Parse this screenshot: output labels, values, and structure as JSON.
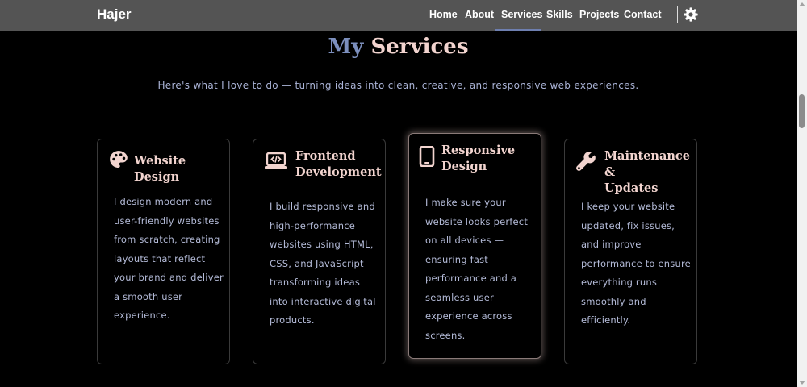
{
  "navbar": {
    "brand": "Hajer",
    "links": [
      {
        "label": "Home",
        "active": false
      },
      {
        "label": "About",
        "active": false
      },
      {
        "label": "Services",
        "active": true
      },
      {
        "label": "Skills",
        "active": false
      },
      {
        "label": "Projects",
        "active": false
      },
      {
        "label": "Contact",
        "active": false
      }
    ],
    "settings_icon": "gear-icon"
  },
  "section": {
    "title_part1": "My",
    "title_part2": "Services",
    "subtitle": "Here's what I love to do — turning ideas into clean, creative, and responsive web experiences."
  },
  "cards": [
    {
      "icon": "palette-icon",
      "title_lines": [
        "Website Design"
      ],
      "desc_lines": [
        "I design modern and",
        "user-friendly websites",
        "from scratch, creating",
        "layouts that reflect",
        "your brand and deliver",
        "a smooth user",
        "experience."
      ]
    },
    {
      "icon": "code-laptop-icon",
      "title_lines": [
        "Frontend",
        "Development"
      ],
      "desc_lines": [
        "I build responsive and",
        "high-performance",
        "websites using HTML,",
        "CSS, and JavaScript —",
        "transforming ideas",
        "into interactive digital",
        "products."
      ]
    },
    {
      "icon": "mobile-icon",
      "title_lines": [
        "Responsive",
        "Design"
      ],
      "desc_lines": [
        "I make sure your",
        "website looks perfect",
        "on all devices —",
        "ensuring fast",
        "performance and a",
        "seamless user",
        "experience across",
        "screens."
      ]
    },
    {
      "icon": "wrench-icon",
      "title_lines": [
        "Maintenance &",
        "Updates"
      ],
      "desc_lines": [
        "I keep your website",
        "updated, fix issues,",
        "and improve",
        "performance to ensure",
        "everything runs",
        "smoothly and",
        "efficiently."
      ]
    }
  ],
  "colors": {
    "background": "#000000",
    "navbar": "#545454",
    "accent_blue": "#7c8fbd",
    "accent_pink": "#f2d4cf",
    "body_text": "#b4bbd8"
  }
}
